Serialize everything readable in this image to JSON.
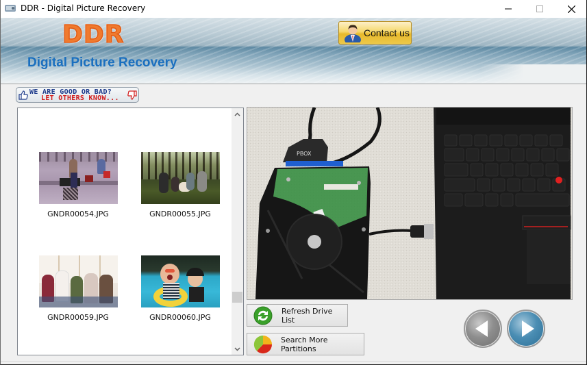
{
  "window": {
    "title": "DDR - Digital Picture Recovery",
    "controls": {
      "minimize": "minimize",
      "maximize": "maximize",
      "close": "close"
    }
  },
  "banner": {
    "logo": "DDR",
    "subtitle": "Digital Picture Recovery",
    "contact_label": "Contact us"
  },
  "feedback": {
    "line1": "WE ARE GOOD OR BAD?",
    "line2": "LET OTHERS KNOW..."
  },
  "files": [
    {
      "name": "GNDR00054.JPG",
      "thumb": "people-sitting-steps"
    },
    {
      "name": "GNDR00055.JPG",
      "thumb": "picnic-in-park"
    },
    {
      "name": "GNDR00059.JPG",
      "thumb": "group-on-bench"
    },
    {
      "name": "GNDR00060.JPG",
      "thumb": "friends-in-pool"
    }
  ],
  "preview": {
    "subject": "hard-drive-connected-to-laptop",
    "adapter_label": "PBOX"
  },
  "actions": {
    "refresh_label": "Refresh Drive List",
    "search_label": "Search More Partitions"
  },
  "navigation": {
    "prev": "previous",
    "next": "next"
  },
  "colors": {
    "logo_orange": "#f07a2e",
    "subtitle_blue": "#1a6fbf",
    "feedback_blue": "#1d3a8a",
    "feedback_red": "#d11a1a",
    "contact_gold": "#e7b92b"
  }
}
